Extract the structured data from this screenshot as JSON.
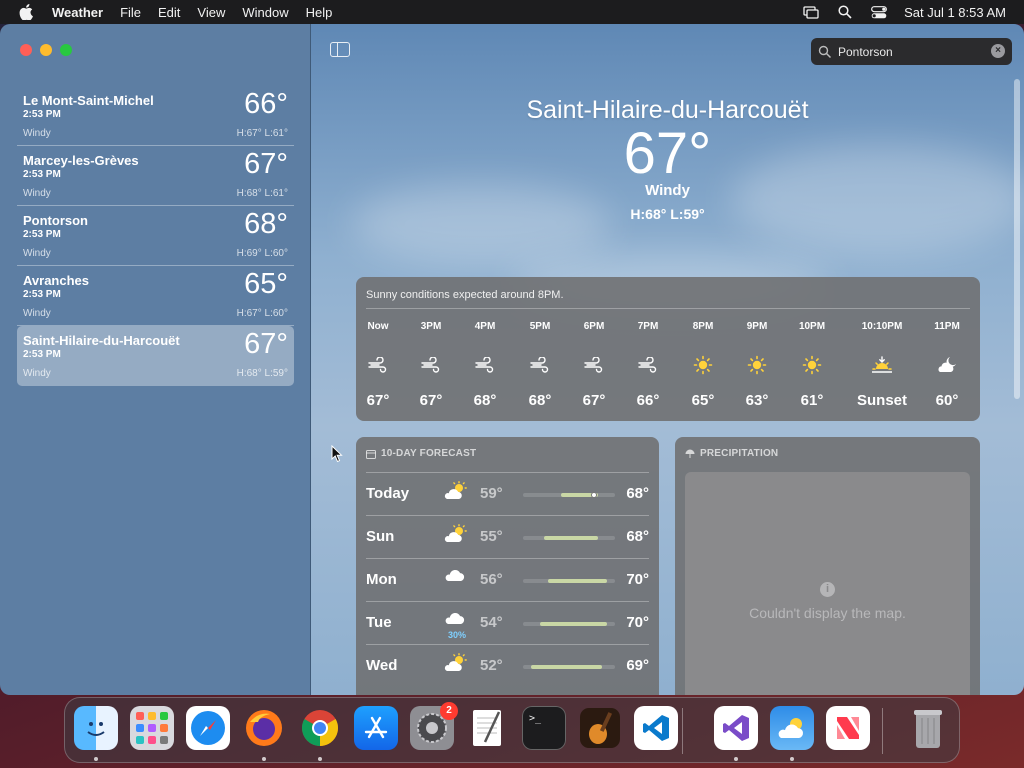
{
  "menubar": {
    "app_name": "Weather",
    "menus": [
      "File",
      "Edit",
      "View",
      "Window",
      "Help"
    ],
    "clock": "Sat Jul 1  8:53 AM"
  },
  "sidebar": {
    "locations": [
      {
        "name": "Le Mont-Saint-Michel",
        "time": "2:53 PM",
        "condition": "Windy",
        "temp": "66°",
        "hl": "H:67°  L:61°",
        "selected": false
      },
      {
        "name": "Marcey-les-Grèves",
        "time": "2:53 PM",
        "condition": "Windy",
        "temp": "67°",
        "hl": "H:68°  L:61°",
        "selected": false
      },
      {
        "name": "Pontorson",
        "time": "2:53 PM",
        "condition": "Windy",
        "temp": "68°",
        "hl": "H:69°  L:60°",
        "selected": false
      },
      {
        "name": "Avranches",
        "time": "2:53 PM",
        "condition": "Windy",
        "temp": "65°",
        "hl": "H:67°  L:60°",
        "selected": false
      },
      {
        "name": "Saint-Hilaire-du-Harcouët",
        "time": "2:53 PM",
        "condition": "Windy",
        "temp": "67°",
        "hl": "H:68°  L:59°",
        "selected": true
      }
    ]
  },
  "search": {
    "value": "Pontorson",
    "placeholder": "Search"
  },
  "current": {
    "city": "Saint-Hilaire-du-Harcouët",
    "temp": "67°",
    "condition": "Windy",
    "hl": "H:68°  L:59°"
  },
  "hourly": {
    "summary": "Sunny conditions expected around 8PM.",
    "hours": [
      {
        "label": "Now",
        "icon": "wind-icon",
        "temp": "67°"
      },
      {
        "label": "3PM",
        "icon": "wind-icon",
        "temp": "67°"
      },
      {
        "label": "4PM",
        "icon": "wind-icon",
        "temp": "68°"
      },
      {
        "label": "5PM",
        "icon": "wind-icon",
        "temp": "68°"
      },
      {
        "label": "6PM",
        "icon": "wind-icon",
        "temp": "67°"
      },
      {
        "label": "7PM",
        "icon": "wind-icon",
        "temp": "66°"
      },
      {
        "label": "8PM",
        "icon": "sun-icon",
        "temp": "65°"
      },
      {
        "label": "9PM",
        "icon": "sun-icon",
        "temp": "63°"
      },
      {
        "label": "10PM",
        "icon": "sun-icon",
        "temp": "61°"
      },
      {
        "label": "10:10PM",
        "icon": "sunset-icon",
        "temp": "Sunset"
      },
      {
        "label": "11PM",
        "icon": "moon-cloud-icon",
        "temp": "60°"
      }
    ]
  },
  "forecast": {
    "title": "10-DAY FORECAST",
    "range": {
      "min": 50,
      "max": 72
    },
    "days": [
      {
        "day": "Today",
        "icon": "partly-sunny-icon",
        "pop": "",
        "lo": "59°",
        "hi": "68°",
        "lo_val": 59,
        "hi_val": 68,
        "current_val": 67
      },
      {
        "day": "Sun",
        "icon": "partly-sunny-icon",
        "pop": "",
        "lo": "55°",
        "hi": "68°",
        "lo_val": 55,
        "hi_val": 68
      },
      {
        "day": "Mon",
        "icon": "cloud-icon",
        "pop": "",
        "lo": "56°",
        "hi": "70°",
        "lo_val": 56,
        "hi_val": 70
      },
      {
        "day": "Tue",
        "icon": "cloud-icon",
        "pop": "30%",
        "lo": "54°",
        "hi": "70°",
        "lo_val": 54,
        "hi_val": 70
      },
      {
        "day": "Wed",
        "icon": "partly-sunny-icon",
        "pop": "",
        "lo": "52°",
        "hi": "69°",
        "lo_val": 52,
        "hi_val": 69
      }
    ]
  },
  "precipitation": {
    "title": "PRECIPITATION",
    "info_glyph": "i",
    "message": "Couldn't display the map."
  },
  "dock": {
    "items": [
      {
        "name": "finder-icon",
        "running": true
      },
      {
        "name": "launchpad-icon",
        "running": false
      },
      {
        "name": "safari-icon",
        "running": false
      },
      {
        "name": "firefox-icon",
        "running": true
      },
      {
        "name": "chrome-icon",
        "running": true
      },
      {
        "name": "app-store-icon",
        "running": false
      },
      {
        "name": "system-settings-icon",
        "running": false,
        "badge": "2"
      },
      {
        "name": "textedit-icon",
        "running": false
      },
      {
        "name": "terminal-icon",
        "running": false
      },
      {
        "name": "garageband-icon",
        "running": false
      },
      {
        "name": "vscode-icon",
        "running": false
      },
      {
        "name": "visual-studio-icon",
        "running": true
      },
      {
        "name": "weather-icon",
        "running": true
      },
      {
        "name": "news-icon",
        "running": false
      },
      {
        "name": "trash-icon",
        "running": false
      }
    ]
  }
}
